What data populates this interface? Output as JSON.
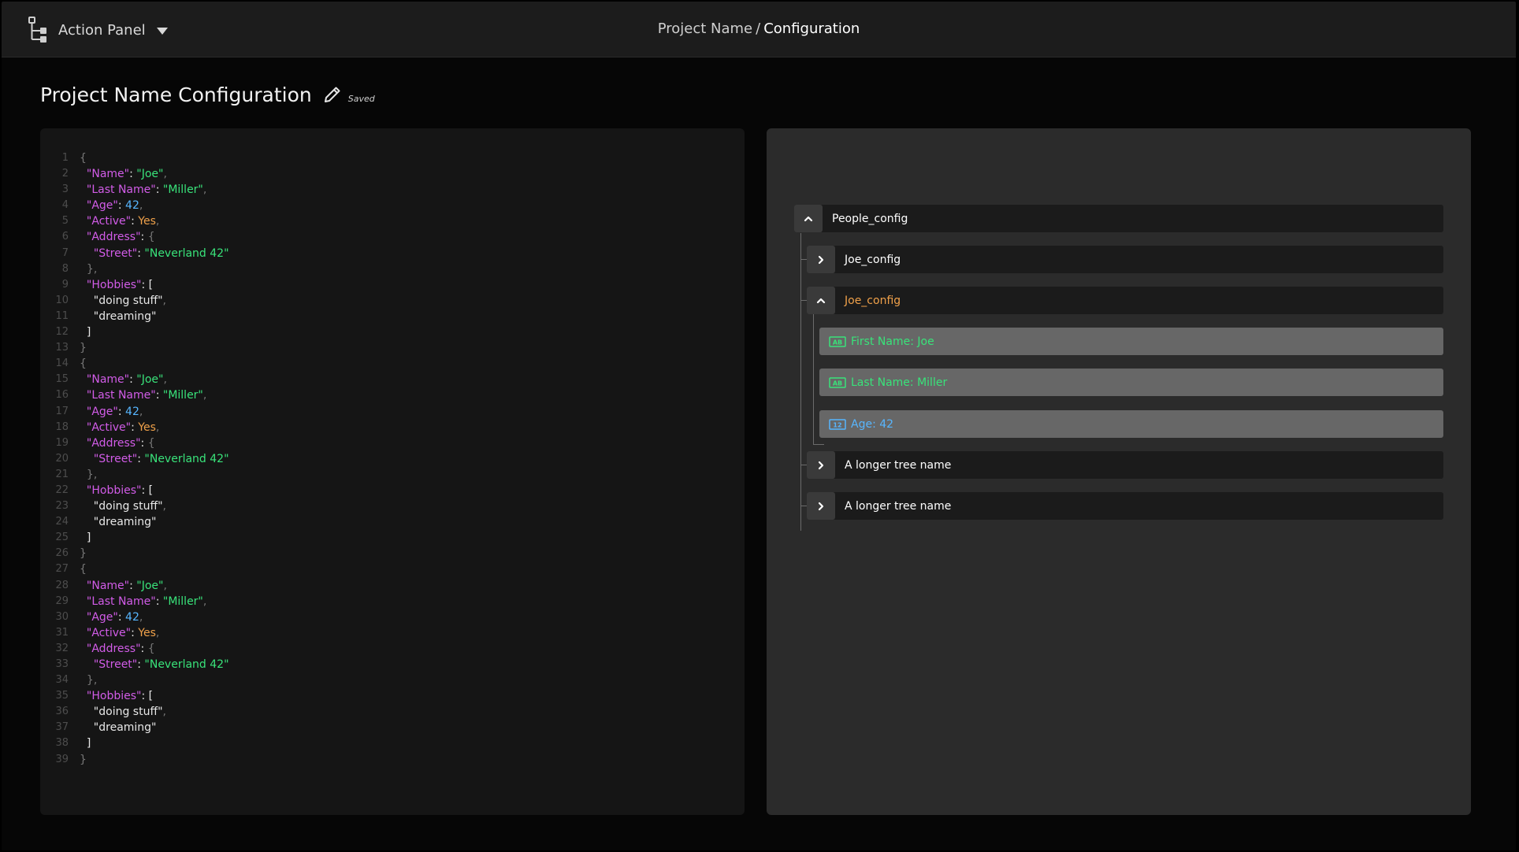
{
  "header": {
    "action_panel_label": "Action Panel",
    "breadcrumb": {
      "project": "Project Name",
      "separator": "/",
      "current": "Configuration"
    }
  },
  "page": {
    "title": "Project Name Configuration",
    "status": "Saved"
  },
  "editor": {
    "lines": [
      {
        "n": "1",
        "t": [
          [
            "punc",
            "{"
          ]
        ]
      },
      {
        "n": "2",
        "t": [
          [
            "plain",
            "  "
          ],
          [
            "key",
            "\"Name\""
          ],
          [
            "plain",
            ": "
          ],
          [
            "str",
            "\"Joe\""
          ],
          [
            "punc",
            ","
          ]
        ]
      },
      {
        "n": "3",
        "t": [
          [
            "plain",
            "  "
          ],
          [
            "key",
            "\"Last Name\""
          ],
          [
            "plain",
            ": "
          ],
          [
            "str",
            "\"Miller\""
          ],
          [
            "punc",
            ","
          ]
        ]
      },
      {
        "n": "4",
        "t": [
          [
            "plain",
            "  "
          ],
          [
            "key",
            "\"Age\""
          ],
          [
            "plain",
            ": "
          ],
          [
            "num",
            "42"
          ],
          [
            "punc",
            ","
          ]
        ]
      },
      {
        "n": "5",
        "t": [
          [
            "plain",
            "  "
          ],
          [
            "key",
            "\"Active\""
          ],
          [
            "plain",
            ": "
          ],
          [
            "bool",
            "Yes"
          ],
          [
            "punc",
            ","
          ]
        ]
      },
      {
        "n": "6",
        "t": [
          [
            "plain",
            "  "
          ],
          [
            "key",
            "\"Address\""
          ],
          [
            "plain",
            ": "
          ],
          [
            "punc",
            "{"
          ]
        ]
      },
      {
        "n": "7",
        "t": [
          [
            "plain",
            "    "
          ],
          [
            "key",
            "\"Street\""
          ],
          [
            "plain",
            ": "
          ],
          [
            "str",
            "\"Neverland 42\""
          ]
        ]
      },
      {
        "n": "8",
        "t": [
          [
            "plain",
            "  "
          ],
          [
            "punc",
            "},"
          ]
        ]
      },
      {
        "n": "9",
        "t": [
          [
            "plain",
            "  "
          ],
          [
            "key",
            "\"Hobbies\""
          ],
          [
            "plain",
            ": ["
          ]
        ]
      },
      {
        "n": "10",
        "t": [
          [
            "plain",
            "    \"doing stuff\""
          ],
          [
            "punc",
            ","
          ]
        ]
      },
      {
        "n": "11",
        "t": [
          [
            "plain",
            "    \"dreaming\""
          ]
        ]
      },
      {
        "n": "12",
        "t": [
          [
            "plain",
            "  ]"
          ]
        ]
      },
      {
        "n": "13",
        "t": [
          [
            "punc",
            "}"
          ]
        ]
      },
      {
        "n": "14",
        "t": [
          [
            "punc",
            "{"
          ]
        ]
      },
      {
        "n": "15",
        "t": [
          [
            "plain",
            "  "
          ],
          [
            "key",
            "\"Name\""
          ],
          [
            "plain",
            ": "
          ],
          [
            "str",
            "\"Joe\""
          ],
          [
            "punc",
            ","
          ]
        ]
      },
      {
        "n": "16",
        "t": [
          [
            "plain",
            "  "
          ],
          [
            "key",
            "\"Last Name\""
          ],
          [
            "plain",
            ": "
          ],
          [
            "str",
            "\"Miller\""
          ],
          [
            "punc",
            ","
          ]
        ]
      },
      {
        "n": "17",
        "t": [
          [
            "plain",
            "  "
          ],
          [
            "key",
            "\"Age\""
          ],
          [
            "plain",
            ": "
          ],
          [
            "num",
            "42"
          ],
          [
            "punc",
            ","
          ]
        ]
      },
      {
        "n": "18",
        "t": [
          [
            "plain",
            "  "
          ],
          [
            "key",
            "\"Active\""
          ],
          [
            "plain",
            ": "
          ],
          [
            "bool",
            "Yes"
          ],
          [
            "punc",
            ","
          ]
        ]
      },
      {
        "n": "19",
        "t": [
          [
            "plain",
            "  "
          ],
          [
            "key",
            "\"Address\""
          ],
          [
            "plain",
            ": "
          ],
          [
            "punc",
            "{"
          ]
        ]
      },
      {
        "n": "20",
        "t": [
          [
            "plain",
            "    "
          ],
          [
            "key",
            "\"Street\""
          ],
          [
            "plain",
            ": "
          ],
          [
            "str",
            "\"Neverland 42\""
          ]
        ]
      },
      {
        "n": "21",
        "t": [
          [
            "plain",
            "  "
          ],
          [
            "punc",
            "},"
          ]
        ]
      },
      {
        "n": "22",
        "t": [
          [
            "plain",
            "  "
          ],
          [
            "key",
            "\"Hobbies\""
          ],
          [
            "plain",
            ": ["
          ]
        ]
      },
      {
        "n": "23",
        "t": [
          [
            "plain",
            "    \"doing stuff\""
          ],
          [
            "punc",
            ","
          ]
        ]
      },
      {
        "n": "24",
        "t": [
          [
            "plain",
            "    \"dreaming\""
          ]
        ]
      },
      {
        "n": "25",
        "t": [
          [
            "plain",
            "  ]"
          ]
        ]
      },
      {
        "n": "26",
        "t": [
          [
            "punc",
            "}"
          ]
        ]
      },
      {
        "n": "27",
        "t": [
          [
            "punc",
            "{"
          ]
        ]
      },
      {
        "n": "28",
        "t": [
          [
            "plain",
            "  "
          ],
          [
            "key",
            "\"Name\""
          ],
          [
            "plain",
            ": "
          ],
          [
            "str",
            "\"Joe\""
          ],
          [
            "punc",
            ","
          ]
        ]
      },
      {
        "n": "29",
        "t": [
          [
            "plain",
            "  "
          ],
          [
            "key",
            "\"Last Name\""
          ],
          [
            "plain",
            ": "
          ],
          [
            "str",
            "\"Miller\""
          ],
          [
            "punc",
            ","
          ]
        ]
      },
      {
        "n": "30",
        "t": [
          [
            "plain",
            "  "
          ],
          [
            "key",
            "\"Age\""
          ],
          [
            "plain",
            ": "
          ],
          [
            "num",
            "42"
          ],
          [
            "punc",
            ","
          ]
        ]
      },
      {
        "n": "31",
        "t": [
          [
            "plain",
            "  "
          ],
          [
            "key",
            "\"Active\""
          ],
          [
            "plain",
            ": "
          ],
          [
            "bool",
            "Yes"
          ],
          [
            "punc",
            ","
          ]
        ]
      },
      {
        "n": "32",
        "t": [
          [
            "plain",
            "  "
          ],
          [
            "key",
            "\"Address\""
          ],
          [
            "plain",
            ": "
          ],
          [
            "punc",
            "{"
          ]
        ]
      },
      {
        "n": "33",
        "t": [
          [
            "plain",
            "    "
          ],
          [
            "key",
            "\"Street\""
          ],
          [
            "plain",
            ": "
          ],
          [
            "str",
            "\"Neverland 42\""
          ]
        ]
      },
      {
        "n": "34",
        "t": [
          [
            "plain",
            "  "
          ],
          [
            "punc",
            "},"
          ]
        ]
      },
      {
        "n": "35",
        "t": [
          [
            "plain",
            "  "
          ],
          [
            "key",
            "\"Hobbies\""
          ],
          [
            "plain",
            ": ["
          ]
        ]
      },
      {
        "n": "36",
        "t": [
          [
            "plain",
            "    \"doing stuff\""
          ],
          [
            "punc",
            ","
          ]
        ]
      },
      {
        "n": "37",
        "t": [
          [
            "plain",
            "    \"dreaming\""
          ]
        ]
      },
      {
        "n": "38",
        "t": [
          [
            "plain",
            "  ]"
          ]
        ]
      },
      {
        "n": "39",
        "t": [
          [
            "punc",
            "}"
          ]
        ]
      }
    ]
  },
  "tree": {
    "root": {
      "label": "People_config",
      "expanded": true
    },
    "children": [
      {
        "label": "Joe_config",
        "expanded": false
      },
      {
        "label": "Joe_config",
        "expanded": true
      },
      {
        "label": "A longer tree name",
        "expanded": false
      },
      {
        "label": "A longer tree name",
        "expanded": false
      }
    ],
    "leaves": [
      {
        "label": "First Name: Joe",
        "kind": "text-field-icon"
      },
      {
        "label": "Last Name: Miller",
        "kind": "text-field-icon"
      },
      {
        "label": "Age: 42",
        "kind": "number-field-icon"
      }
    ]
  },
  "colors": {
    "key": "#d25ce8",
    "string": "#39e37a",
    "number": "#57b6ff",
    "boolean": "#f0a14a"
  }
}
